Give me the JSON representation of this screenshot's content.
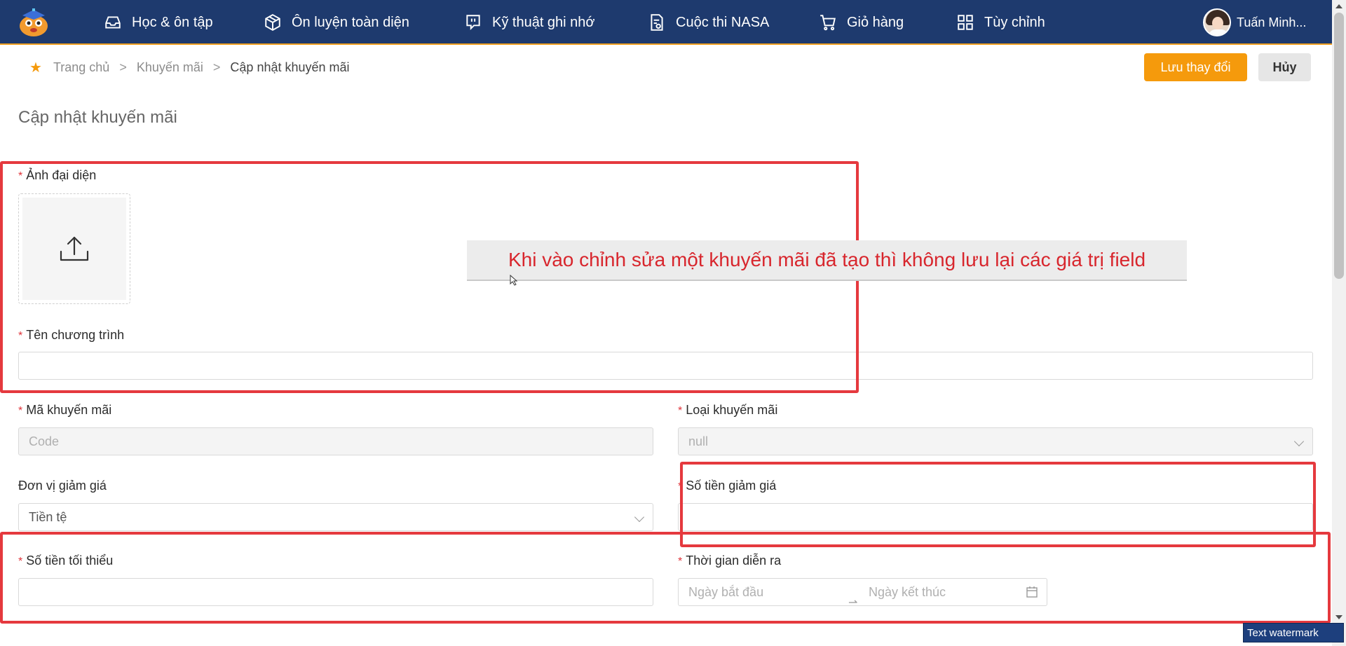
{
  "nav": {
    "items": [
      {
        "label": "Học & ôn tập",
        "icon": "inbox-icon"
      },
      {
        "label": "Ôn luyện toàn diện",
        "icon": "cube-icon"
      },
      {
        "label": "Kỹ thuật ghi nhớ",
        "icon": "chat-bubble-icon"
      },
      {
        "label": "Cuộc thi NASA",
        "icon": "document-icon"
      },
      {
        "label": "Giỏ hàng",
        "icon": "cart-icon"
      },
      {
        "label": "Tùy chỉnh",
        "icon": "grid-icon"
      }
    ],
    "user_name": "Tuấn Minh..."
  },
  "breadcrumb": {
    "home": "Trang chủ",
    "level1": "Khuyến mãi",
    "current": "Cập nhật khuyến mãi",
    "separator": ">"
  },
  "actions": {
    "save_label": "Lưu thay đổi",
    "cancel_label": "Hủy"
  },
  "page_title": "Cập nhật khuyến mãi",
  "form": {
    "required_mark": "*",
    "avatar_label": "Ảnh đại diện",
    "program_name_label": "Tên chương trình",
    "program_name_value": "",
    "code_label": "Mã khuyến mãi",
    "code_placeholder": "Code",
    "type_label": "Loại khuyến mãi",
    "type_value": "null",
    "discount_unit_label": "Đơn vị giảm giá",
    "discount_unit_value": "Tiền tệ",
    "discount_amount_label": "Số tiền giảm giá",
    "discount_amount_value": "",
    "min_amount_label": "Số tiền tối thiểu",
    "min_amount_value": "",
    "duration_label": "Thời gian diễn ra",
    "start_placeholder": "Ngày bắt đầu",
    "end_placeholder": "Ngày kết thúc",
    "range_separator": "⇀"
  },
  "annotation": {
    "text": "Khi vào chỉnh sửa một khuyến mãi đã tạo thì không lưu lại các giá trị field",
    "color": "#d8262d"
  },
  "watermark": "Text watermark",
  "colors": {
    "nav_bg": "#1e3a6e",
    "accent": "#f59a0c",
    "required": "#e0343a"
  }
}
